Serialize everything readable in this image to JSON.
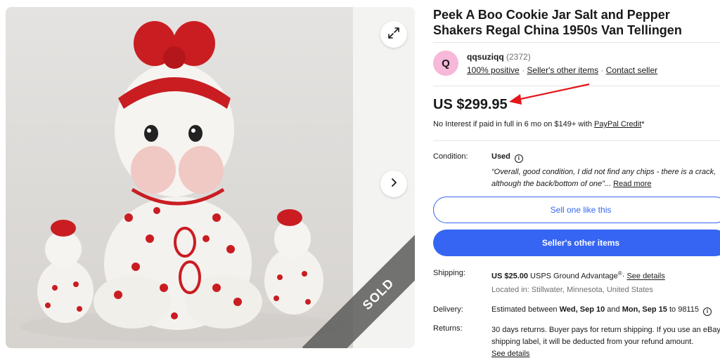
{
  "listing": {
    "title": "Peek A Boo Cookie Jar Salt and Pepper Shakers Regal China 1950s Van Tellingen",
    "image_badge": "SOLD"
  },
  "seller": {
    "avatar_letter": "Q",
    "name": "qqsuziqq",
    "feedback_count": "(2372)",
    "positive": "100% positive",
    "other_items_link": "Seller's other items",
    "contact_link": "Contact seller",
    "separator": "·"
  },
  "pricing": {
    "price": "US $299.95",
    "financing_text": "No Interest if paid in full in 6 mo on $149+ with",
    "financing_link": "PayPal Credit",
    "financing_suffix": "*"
  },
  "condition": {
    "label": "Condition:",
    "value": "Used",
    "quote": "“Overall, good condition, I did not find any chips - there is a crack, although the back/bottom of one”",
    "ellipsis": "...",
    "read_more": "Read more"
  },
  "actions": {
    "sell_one_like_this": "Sell one like this",
    "sellers_other_items": "Seller's other items"
  },
  "shipping": {
    "label": "Shipping:",
    "cost": "US $25.00",
    "service": "USPS Ground Advantage",
    "trademark": "®",
    "details_link": "See details",
    "location": "Located in: Stillwater, Minnesota, United States"
  },
  "delivery": {
    "label": "Delivery:",
    "prefix": "Estimated between",
    "start": "Wed, Sep 10",
    "and": "and",
    "end": "Mon, Sep 15",
    "to": "to 98115"
  },
  "returns": {
    "label": "Returns:",
    "text": "30 days returns. Buyer pays for return shipping. If you use an eBay shipping label, it will be deducted from your refund amount.",
    "details_link": "See details"
  },
  "icons": {
    "expand": "expand-icon",
    "next": "chevron-right-icon",
    "info": "info-icon",
    "annotation": "red-arrow-annotation"
  },
  "colors": {
    "accent": "#3665f3",
    "avatar": "#f7b8d9",
    "annotation_arrow": "#e3161b",
    "ceramic_red": "#cc1f24"
  }
}
